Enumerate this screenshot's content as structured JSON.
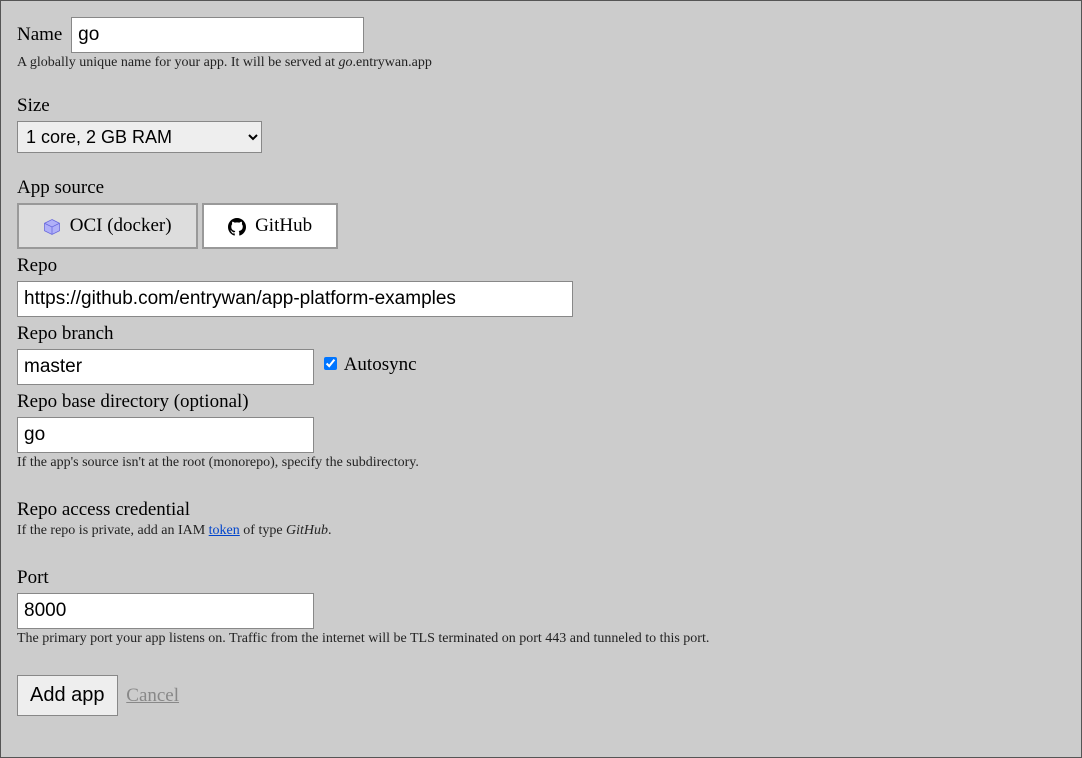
{
  "name": {
    "label": "Name",
    "value": "go",
    "help_prefix": "A globally unique name for your app. It will be served at ",
    "help_domain": "go",
    "help_suffix": ".entrywan.app"
  },
  "size": {
    "label": "Size",
    "selected": "1 core, 2 GB RAM"
  },
  "source": {
    "label": "App source",
    "option_oci": "OCI (docker)",
    "option_github": "GitHub"
  },
  "repo": {
    "label": "Repo",
    "value": "https://github.com/entrywan/app-platform-examples"
  },
  "branch": {
    "label": "Repo branch",
    "value": "master",
    "autosync_label": "Autosync"
  },
  "basedir": {
    "label": "Repo base directory (optional)",
    "value": "go",
    "help": "If the app's source isn't at the root (monorepo), specify the subdirectory."
  },
  "credential": {
    "label": "Repo access credential",
    "help_prefix": "If the repo is private, add an IAM ",
    "help_link": "token",
    "help_mid": " of type ",
    "help_type": "GitHub",
    "help_suffix": "."
  },
  "port": {
    "label": "Port",
    "value": "8000",
    "help": "The primary port your app listens on. Traffic from the internet will be TLS terminated on port 443 and tunneled to this port."
  },
  "actions": {
    "add": "Add app",
    "cancel": "Cancel"
  }
}
